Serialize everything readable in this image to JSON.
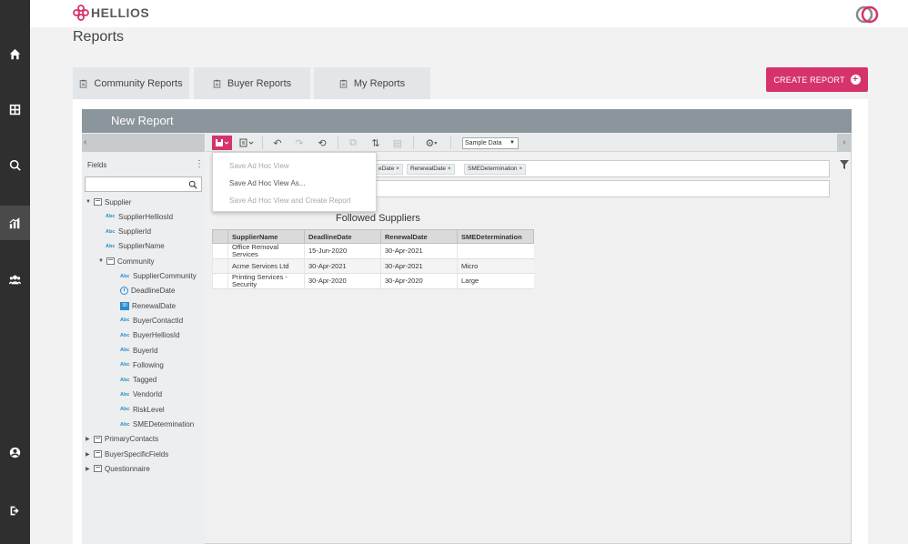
{
  "brand": {
    "name": "HELLIOS",
    "accent": "#d6336c"
  },
  "nav": {
    "items": [
      {
        "name": "home",
        "icon": "home-icon",
        "active": false
      },
      {
        "name": "grid",
        "icon": "grid-icon",
        "active": false
      },
      {
        "name": "search",
        "icon": "search-icon",
        "active": false
      },
      {
        "name": "reports",
        "icon": "bar-chart-icon",
        "active": true
      },
      {
        "name": "people",
        "icon": "people-icon",
        "active": false
      },
      {
        "name": "account",
        "icon": "user-circle-icon",
        "active": false
      },
      {
        "name": "logout",
        "icon": "logout-icon",
        "active": false
      }
    ]
  },
  "page": {
    "title": "Reports"
  },
  "tabs": {
    "community": "Community Reports",
    "buyer": "Buyer Reports",
    "my": "My Reports"
  },
  "create_button": {
    "label": "CREATE REPORT"
  },
  "report": {
    "header": "New Report"
  },
  "toolbar": {
    "sample_data": "Sample Data"
  },
  "fields": {
    "title": "Fields",
    "tree": [
      {
        "label": "Supplier",
        "type": "folder",
        "level": 0,
        "expanded": true
      },
      {
        "label": "SupplierHelliosId",
        "type": "abc",
        "level": 1
      },
      {
        "label": "SupplierId",
        "type": "abc",
        "level": 1
      },
      {
        "label": "SupplierName",
        "type": "abc",
        "level": 1
      },
      {
        "label": "Community",
        "type": "folder",
        "level": 1,
        "expanded": true
      },
      {
        "label": "SupplierCommunity",
        "type": "abc",
        "level": 2
      },
      {
        "label": "DeadlineDate",
        "type": "clock",
        "level": 2
      },
      {
        "label": "RenewalDate",
        "type": "cal",
        "level": 2
      },
      {
        "label": "BuyerContactId",
        "type": "abc",
        "level": 2
      },
      {
        "label": "BuyerHelliosId",
        "type": "abc",
        "level": 2
      },
      {
        "label": "BuyerId",
        "type": "abc",
        "level": 2
      },
      {
        "label": "Following",
        "type": "abc",
        "level": 2
      },
      {
        "label": "Tagged",
        "type": "abc",
        "level": 2
      },
      {
        "label": "VendorId",
        "type": "abc",
        "level": 2
      },
      {
        "label": "RiskLevel",
        "type": "abc",
        "level": 2
      },
      {
        "label": "SMEDetermination",
        "type": "abc",
        "level": 2
      },
      {
        "label": "PrimaryContacts",
        "type": "folder",
        "level": 0,
        "expanded": false
      },
      {
        "label": "BuyerSpecificFields",
        "type": "folder",
        "level": 0,
        "expanded": false
      },
      {
        "label": "Questionnaire",
        "type": "folder",
        "level": 0,
        "expanded": false
      }
    ]
  },
  "pills": [
    "eDate",
    "RenewalDate",
    "SMEDetermination"
  ],
  "dropdown": {
    "items": [
      {
        "label": "Save Ad Hoc View",
        "enabled": false
      },
      {
        "label": "Save Ad Hoc View As...",
        "enabled": true
      },
      {
        "label": "Save Ad Hoc View and Create Report",
        "enabled": false
      }
    ]
  },
  "table": {
    "title": "Followed Suppliers",
    "columns": [
      "SupplierName",
      "DeadlineDate",
      "RenewalDate",
      "SMEDetermination"
    ],
    "rows": [
      [
        "Office Removal\nServices",
        "15-Jun-2020",
        "30-Apr-2021",
        ""
      ],
      [
        "Acme Services Ltd",
        "30-Apr-2021",
        "30-Apr-2021",
        "Micro"
      ],
      [
        "Printing Services -\nSecurity",
        "30-Apr-2020",
        "30-Apr-2020",
        "Large"
      ]
    ]
  }
}
